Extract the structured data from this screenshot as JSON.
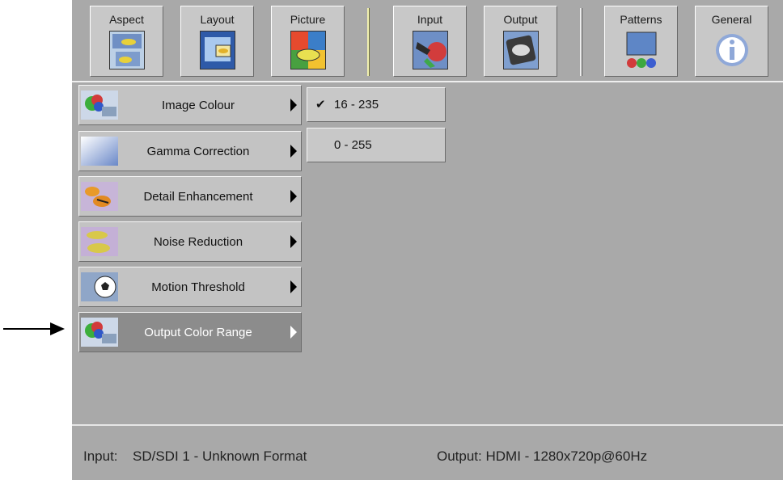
{
  "tabs": [
    {
      "label": "Aspect"
    },
    {
      "label": "Layout"
    },
    {
      "label": "Picture"
    },
    {
      "label": "Input"
    },
    {
      "label": "Output"
    },
    {
      "label": "Patterns"
    },
    {
      "label": "General"
    }
  ],
  "menu": {
    "items": [
      {
        "label": "Image Colour"
      },
      {
        "label": "Gamma Correction"
      },
      {
        "label": "Detail Enhancement"
      },
      {
        "label": "Noise Reduction"
      },
      {
        "label": "Motion Threshold"
      },
      {
        "label": "Output Color Range"
      }
    ],
    "selected": "Output Color Range"
  },
  "submenu": {
    "options": [
      {
        "label": "16 - 235",
        "checked": true,
        "check_glyph": "✔"
      },
      {
        "label": "0 - 255",
        "checked": false
      }
    ]
  },
  "status": {
    "input_label": "Input:",
    "input_value": "SD/SDI 1 - Unknown Format",
    "output_text": "Output: HDMI - 1280x720p@60Hz"
  },
  "icons": {
    "aspect": "fish-aspect-icon",
    "layout": "fish-layout-icon",
    "picture": "fish-picture-icon",
    "input": "connector-plug-icon",
    "output": "vxp-chip-icon",
    "patterns": "monitor-rgb-icon",
    "general": "info-icon"
  }
}
